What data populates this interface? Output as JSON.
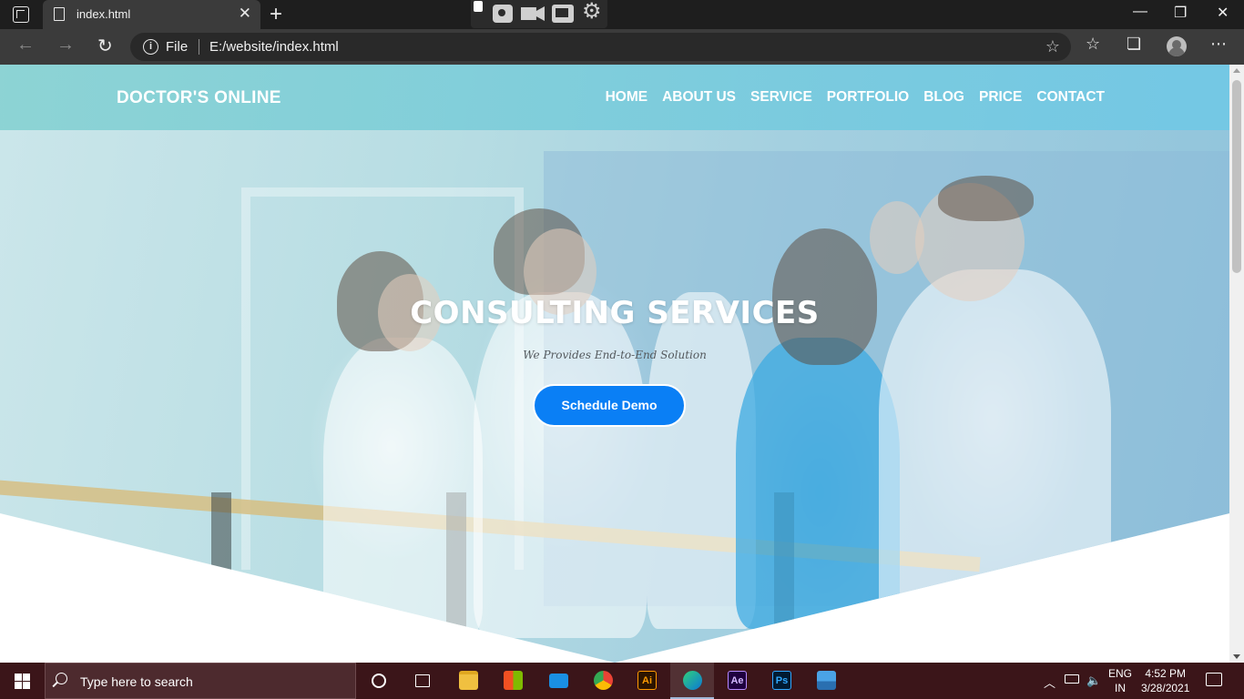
{
  "browser": {
    "tab_title": "index.html",
    "tab_close": "✕",
    "new_tab": "+",
    "scheme_label": "File",
    "url": "E:/website/index.html",
    "window_controls": {
      "minimize": "—",
      "maximize": "❐",
      "close": "✕"
    }
  },
  "site": {
    "logo": "DOCTOR'S ONLINE",
    "nav": [
      "HOME",
      "ABOUT US",
      "SERVICE",
      "PORTFOLIO",
      "BLOG",
      "PRICE",
      "CONTACT"
    ],
    "hero_title": "CONSULTING SERVICES",
    "hero_subtitle": "We Provides End-to-End Solution",
    "cta_label": "Schedule Demo",
    "accent_color": "#0a7ff5"
  },
  "taskbar": {
    "search_placeholder": "Type here to search",
    "apps": [
      {
        "name": "cortana",
        "label": ""
      },
      {
        "name": "task-view",
        "label": ""
      },
      {
        "name": "file-explorer",
        "label": ""
      },
      {
        "name": "microsoft-store",
        "label": ""
      },
      {
        "name": "mail",
        "label": ""
      },
      {
        "name": "chrome",
        "label": ""
      },
      {
        "name": "illustrator",
        "label": "Ai"
      },
      {
        "name": "edge",
        "label": ""
      },
      {
        "name": "after-effects",
        "label": "Ae"
      },
      {
        "name": "photoshop",
        "label": "Ps"
      },
      {
        "name": "photos",
        "label": ""
      }
    ],
    "language_line1": "ENG",
    "language_line2": "IN",
    "time": "4:52 PM",
    "date": "3/28/2021"
  }
}
